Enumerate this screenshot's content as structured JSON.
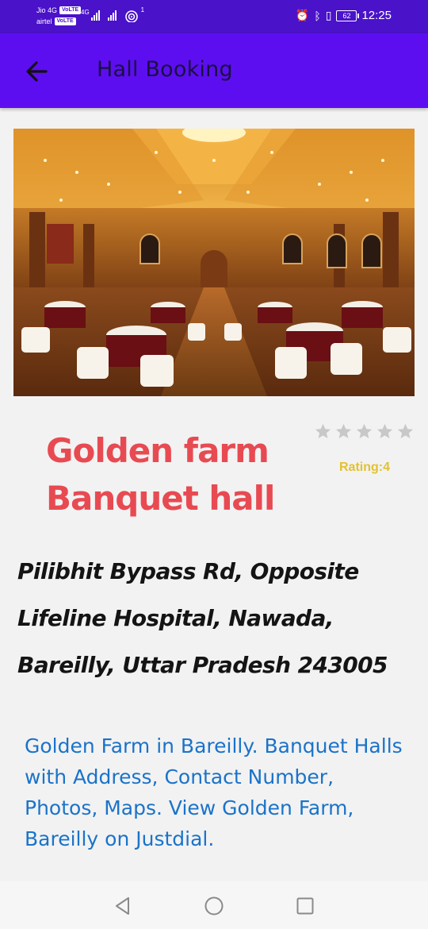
{
  "status_bar": {
    "carrier_1": "Jio 4G",
    "carrier_2": "airtel",
    "volte": "VoLTE",
    "network_type": "4G",
    "wifi_badge": "1",
    "battery": "62",
    "time": "12:25"
  },
  "app_bar": {
    "title": "Hall Booking",
    "back_icon": "arrow-left-icon",
    "color": "#5d0ef0"
  },
  "hall": {
    "image_alt": "banquet-hall-photo",
    "name": "Golden farm Banquet hall",
    "rating": 4,
    "rating_max": 5,
    "rating_label": "Rating:4",
    "address": "Pilibhit Bypass Rd, Opposite\nLifeline Hospital, Nawada,\nBareilly, Uttar Pradesh 243005",
    "description": "Golden Farm in Bareilly. Banquet Halls with Address, Contact Number, Photos, Maps. View Golden Farm, Bareilly on Justdial."
  },
  "colors": {
    "name": "#e84a52",
    "rating": "#e2c231",
    "description": "#1a73c9",
    "stars_empty": "#c8c8c8"
  },
  "nav_bar": {
    "back_icon": "triangle-back-icon",
    "home_icon": "circle-home-icon",
    "recents_icon": "square-recents-icon"
  }
}
